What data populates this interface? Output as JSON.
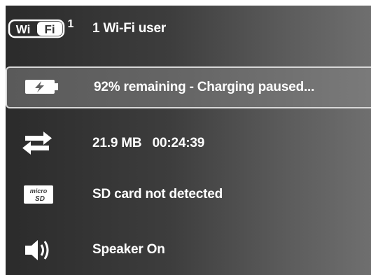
{
  "status_list": {
    "wifi": {
      "icon": "wifi-icon",
      "badge_left": "Wi",
      "badge_right": "Fi",
      "count": "1",
      "label": "1 Wi-Fi user"
    },
    "battery": {
      "icon": "battery-charging-icon",
      "label": "92% remaining - Charging paused..."
    },
    "data": {
      "icon": "data-transfer-icon",
      "label": "21.9 MB   00:24:39"
    },
    "sd_card": {
      "icon": "microsd-card-icon",
      "icon_text_top": "micro",
      "icon_text_bottom": "SD",
      "label": "SD card not detected"
    },
    "speaker": {
      "icon": "speaker-icon",
      "label": "Speaker On"
    }
  },
  "colors": {
    "text": "#ffffff",
    "selected_border": "#d8d8d8"
  }
}
